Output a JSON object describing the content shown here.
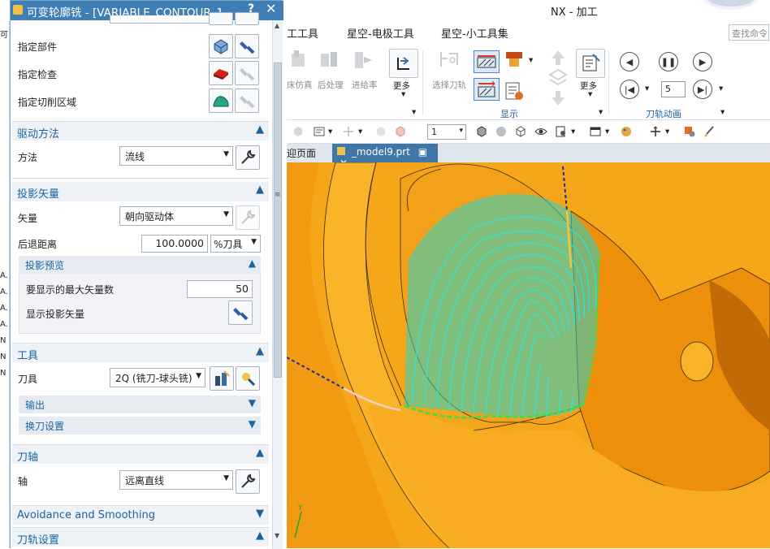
{
  "app": {
    "title": "NX - 加工"
  },
  "ribbon": {
    "tabs": [
      "工工具",
      "星空-电极工具",
      "星空-小工具集"
    ],
    "search_placeholder": "查找命令",
    "buttons": {
      "simulate": "床仿真",
      "postprocess": "后处理",
      "feed": "进给率",
      "more1": "更多",
      "select_path": "选择刀轨",
      "more2": "更多"
    },
    "groups": {
      "display": "显示",
      "animation": "刀轨动画"
    },
    "speed_value": "5"
  },
  "toolbar": {
    "layer_value": "1"
  },
  "doc_tabs": {
    "welcome": "迎页面",
    "active": "_model9.prt"
  },
  "left_strip": [
    "可",
    "A.",
    "A.",
    "A.",
    "A.",
    "N",
    "N",
    "N"
  ],
  "dialog": {
    "title": "可变轮廓铣 - [VARIABLE_CONTOUR_1...",
    "help": "?",
    "close": "✕",
    "geometry": {
      "specify_part": "指定部件",
      "specify_check": "指定检查",
      "specify_cut_area": "指定切削区域"
    },
    "drive": {
      "section": "驱动方法",
      "method_label": "方法",
      "method_value": "流线"
    },
    "projection": {
      "section": "投影矢量",
      "vector_label": "矢量",
      "vector_value": "朝向驱动体",
      "retract_label": "后退距离",
      "retract_value": "100.0000",
      "retract_unit": "%刀具",
      "preview_title": "投影预览",
      "max_vectors_label": "要显示的最大矢量数",
      "max_vectors_value": "50",
      "show_vectors_label": "显示投影矢量"
    },
    "tool": {
      "section": "工具",
      "tool_label": "刀具",
      "tool_value": "2Q (铣刀-球头铣)",
      "output": "输出",
      "tool_change": "换刀设置"
    },
    "tool_axis": {
      "section": "刀轴",
      "axis_label": "轴",
      "axis_value": "远离直线"
    },
    "avoidance": "Avoidance and Smoothing",
    "path_settings": "刀轨设置"
  },
  "colors": {
    "title_bar": "#3f7fb6",
    "section_text": "#1a64a0",
    "part_orange": "#f4a61b",
    "toolpath_cyan": "#2fe3d8"
  }
}
